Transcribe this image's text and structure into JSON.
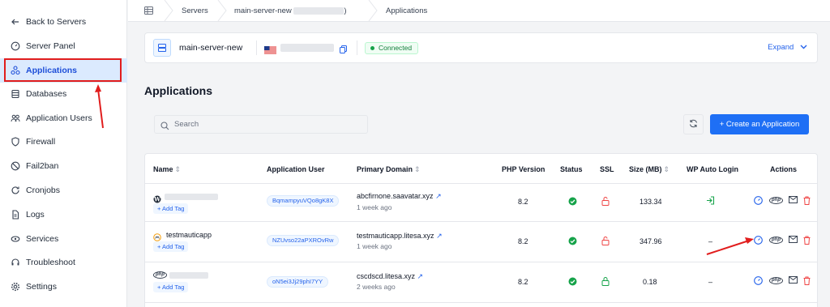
{
  "sidebar": {
    "items": [
      {
        "label": "Back to Servers",
        "icon": "arrow-left-icon"
      },
      {
        "label": "Server Panel",
        "icon": "gauge-icon"
      },
      {
        "label": "Applications",
        "icon": "apps-icon"
      },
      {
        "label": "Databases",
        "icon": "database-icon"
      },
      {
        "label": "Application Users",
        "icon": "users-icon"
      },
      {
        "label": "Firewall",
        "icon": "shield-icon"
      },
      {
        "label": "Fail2ban",
        "icon": "ban-icon"
      },
      {
        "label": "Cronjobs",
        "icon": "refresh-icon"
      },
      {
        "label": "Logs",
        "icon": "file-icon"
      },
      {
        "label": "Services",
        "icon": "services-icon"
      },
      {
        "label": "Troubleshoot",
        "icon": "headset-icon"
      },
      {
        "label": "Settings",
        "icon": "gear-icon"
      }
    ]
  },
  "breadcrumb": {
    "servers": "Servers",
    "server": "main-server-new",
    "server_suffix": ")",
    "current": "Applications"
  },
  "server": {
    "name": "main-server-new",
    "status": "Connected",
    "expand": "Expand"
  },
  "page": {
    "title": "Applications",
    "search_placeholder": "Search",
    "create_label": "+ Create an Application"
  },
  "table": {
    "headers": {
      "name": "Name",
      "user": "Application User",
      "domain": "Primary Domain",
      "php": "PHP Version",
      "status": "Status",
      "ssl": "SSL",
      "size": "Size (MB)",
      "autologin": "WP Auto Login",
      "actions": "Actions"
    },
    "sort_glyph": "⇕",
    "add_tag": "+ Add Tag",
    "rows": [
      {
        "name": "",
        "user": "BqmampyuVQo8gK8X",
        "domain": "abcfirnone.saavatar.xyz",
        "time": "1 week ago",
        "php": "8.2",
        "size": "133.34",
        "autologin": "login",
        "ssl": "red"
      },
      {
        "name": "testmauticapp",
        "user": "NZUvso22aPXROvRw",
        "domain": "testmauticapp.litesa.xyz",
        "time": "1 week ago",
        "php": "8.2",
        "size": "347.96",
        "autologin": "–",
        "ssl": "red"
      },
      {
        "name": "",
        "user": "oN5ei3Jj29phI7YY",
        "domain": "cscdscd.litesa.xyz",
        "time": "2 weeks ago",
        "php": "8.2",
        "size": "0.18",
        "autologin": "–",
        "ssl": "green"
      }
    ]
  },
  "colors": {
    "accent": "#1e6ff5",
    "ok": "#16a34a",
    "danger": "#ef4444",
    "annotation": "#e11d1d"
  }
}
